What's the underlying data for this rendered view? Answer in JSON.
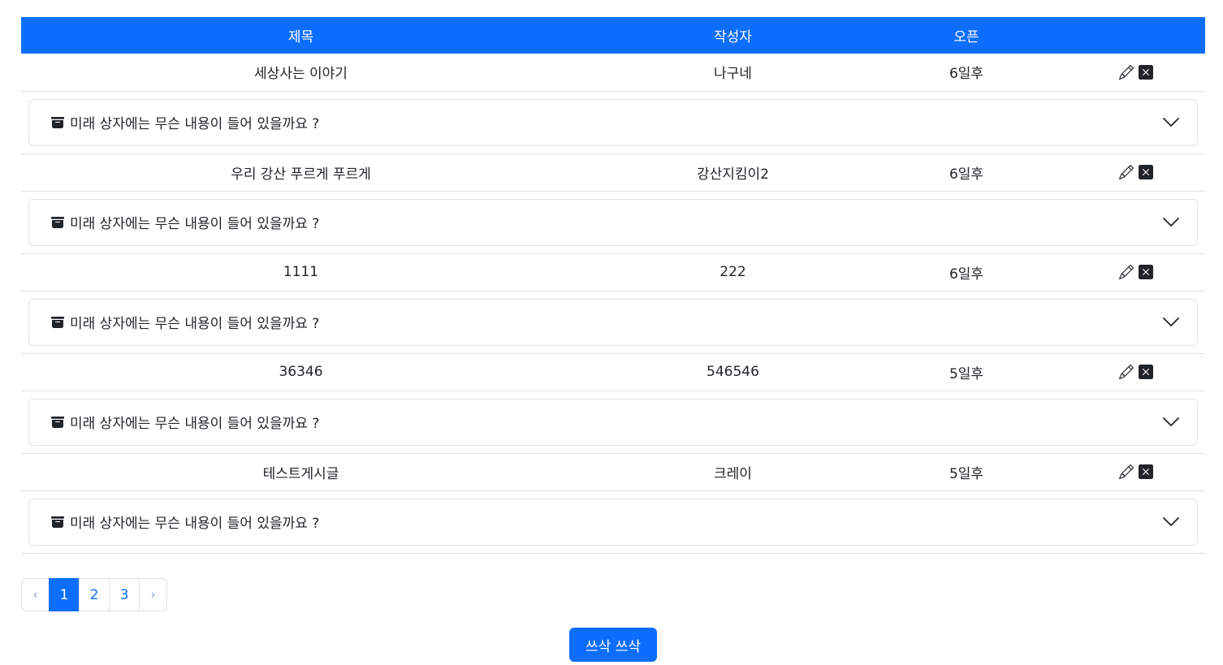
{
  "table": {
    "headers": {
      "title": "제목",
      "author": "작성자",
      "open": "오픈",
      "actions": ""
    },
    "rows": [
      {
        "title": "세상사는 이야기",
        "author": "나구네",
        "open": "6일후",
        "accordion": "미래 상자에는 무슨 내용이 들어 있을까요 ?"
      },
      {
        "title": "우리 강산 푸르게 푸르게",
        "author": "강산지킴이2",
        "open": "6일후",
        "accordion": "미래 상자에는 무슨 내용이 들어 있을까요 ?"
      },
      {
        "title": "1111",
        "author": "222",
        "open": "6일후",
        "accordion": "미래 상자에는 무슨 내용이 들어 있을까요 ?"
      },
      {
        "title": "36346",
        "author": "546546",
        "open": "5일후",
        "accordion": "미래 상자에는 무슨 내용이 들어 있을까요 ?"
      },
      {
        "title": "테스트게시글",
        "author": "크레이",
        "open": "5일후",
        "accordion": "미래 상자에는 무슨 내용이 들어 있을까요 ?"
      }
    ]
  },
  "pagination": {
    "prev": "‹",
    "pages": [
      "1",
      "2",
      "3"
    ],
    "active_page": "1",
    "next": "›"
  },
  "write_button": "쓰삭 쓰삭",
  "icons": {
    "header": "blue-header",
    "row_edit": "pencil-icon",
    "row_delete": "x-square-fill-icon",
    "accordion_box": "archive-box-icon",
    "accordion_toggle": "chevron-down-icon"
  },
  "colors": {
    "primary": "#0d6efd",
    "border": "#dee2e6",
    "text": "#212529"
  }
}
